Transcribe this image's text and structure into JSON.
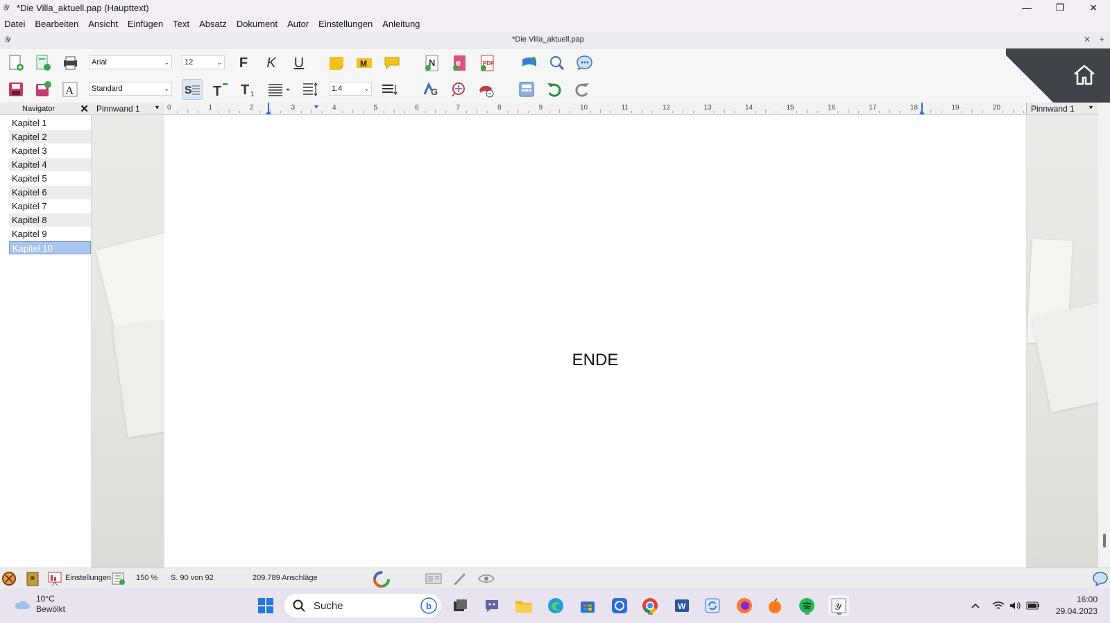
{
  "window": {
    "title": "*Die Villa_aktuell.pap  (Haupttext)",
    "doc_title": "*Die Villa_aktuell.pap"
  },
  "menu": [
    "Datei",
    "Bearbeiten",
    "Ansicht",
    "Einfügen",
    "Text",
    "Absatz",
    "Dokument",
    "Autor",
    "Einstellungen",
    "Anleitung"
  ],
  "toolbar": {
    "font": "Arial",
    "size": "12",
    "style": "Standard",
    "line_spacing": "1.4",
    "bold_label": "F",
    "italic_label": "K",
    "underline_label": "U"
  },
  "navigator": {
    "title": "Navigator",
    "items": [
      "Kapitel 1",
      "Kapitel 2",
      "Kapitel 3",
      "Kapitel 4",
      "Kapitel 5",
      "Kapitel 6",
      "Kapitel 7",
      "Kapitel 8",
      "Kapitel 9",
      "Kapitel 10"
    ],
    "selected": "Kapitel 10"
  },
  "pinboard": {
    "left_label": "Pinnwand 1",
    "right_label": "Pinnwand 1"
  },
  "ruler": {
    "labels": [
      "0",
      "1",
      "2",
      "3",
      "4",
      "5",
      "6",
      "7",
      "8",
      "9",
      "10",
      "11",
      "12",
      "13",
      "14",
      "15",
      "16",
      "17",
      "18",
      "19",
      "20"
    ]
  },
  "page": {
    "text": "ENDE"
  },
  "status": {
    "settings_label": "Einstellungen",
    "zoom": "150 %",
    "page_info": "S. 90 von 92",
    "char_count": "209.789 Anschläge"
  },
  "taskbar": {
    "temperature": "10°C",
    "weather": "Bewölkt",
    "search_placeholder": "Suche",
    "time": "16:00",
    "date": "29.04.2023"
  },
  "colors": {
    "accent": "#a9c5ee",
    "home_corner": "#3e4449"
  }
}
